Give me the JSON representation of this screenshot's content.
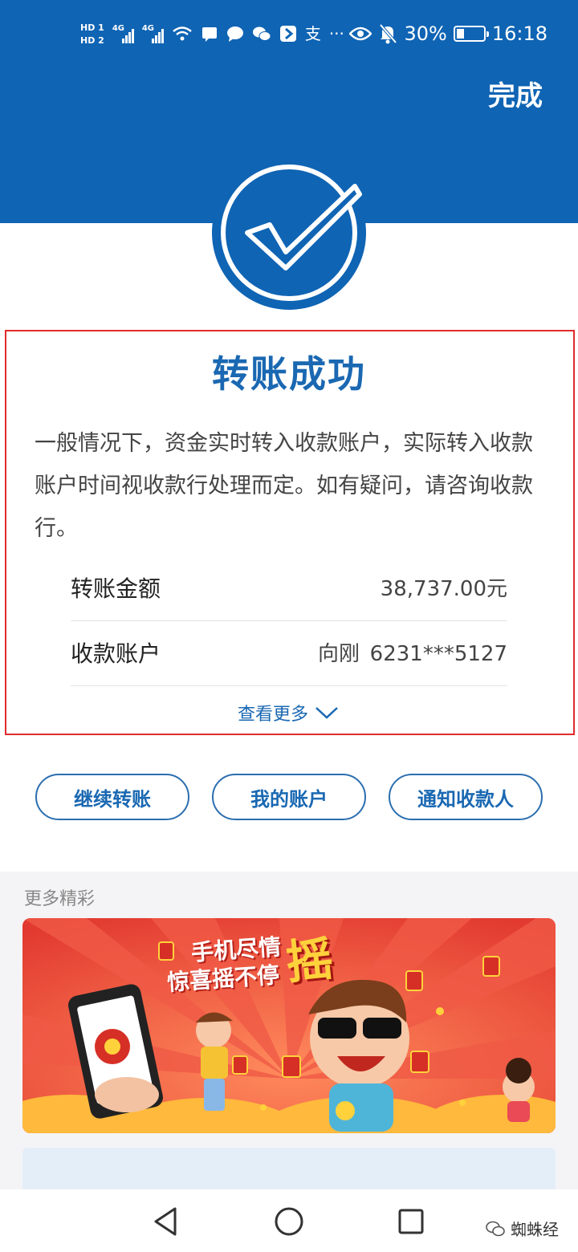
{
  "status_bar": {
    "hd1": "HD 1",
    "hd2": "HD 2",
    "net1": "4G",
    "net2": "4G",
    "alipay_char": "支",
    "ellipsis": "···",
    "battery": "30%",
    "time": "16:18"
  },
  "header": {
    "done_label": "完成"
  },
  "result": {
    "title": "转账成功",
    "description": "一般情况下，资金实时转入收款账户，实际转入收款账户时间视收款行处理而定。如有疑问，请咨询收款行。",
    "amount_label": "转账金额",
    "amount_value": "38,737.00元",
    "account_label": "收款账户",
    "account_name": "向刚",
    "account_number": "6231***5127",
    "view_more": "查看更多"
  },
  "actions": {
    "continue_label": "继续转账",
    "my_account_label": "我的账户",
    "notify_label": "通知收款人"
  },
  "more": {
    "title": "更多精彩",
    "banner_line1": "手机尽情",
    "banner_line2": "惊喜摇不停",
    "banner_big": "摇"
  },
  "watermark": "蜘蛛经",
  "colors": {
    "brand_blue": "#0f64b4",
    "highlight_red": "#e02b2b",
    "banner_red": "#e8463c"
  }
}
